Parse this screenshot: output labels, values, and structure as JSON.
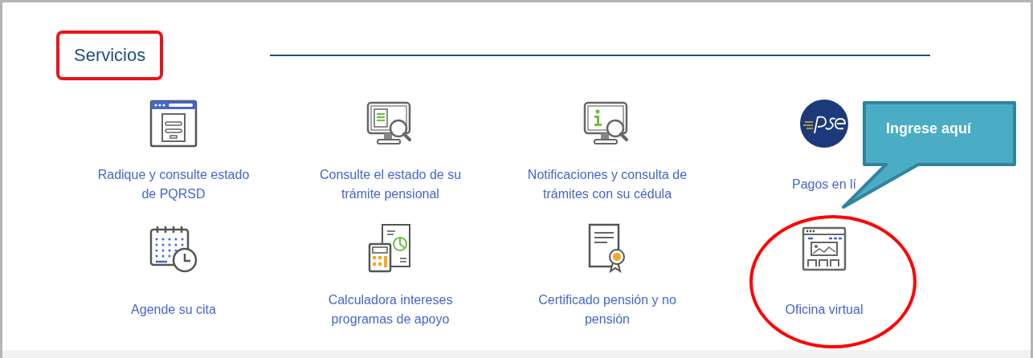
{
  "section": {
    "title": "Servicios",
    "boxed": true
  },
  "services": [
    {
      "label": "Radique y consulte estado\nde PQRSD",
      "kind": "form",
      "circled": false
    },
    {
      "label": "Consulte el estado de su\ntrámite pensional",
      "kind": "monitor-doc",
      "circled": false
    },
    {
      "label": "Notificaciones y consulta de\ntrámites con su cédula",
      "kind": "monitor-info",
      "circled": false
    },
    {
      "label": "Pagos en lí",
      "kind": "pse",
      "circled": false
    },
    {
      "label": "Agende su cita",
      "kind": "calendar",
      "circled": false
    },
    {
      "label": "Calculadora intereses\nprogramas de apoyo",
      "kind": "calculator",
      "circled": false
    },
    {
      "label": "Certificado pensión y no\npensión",
      "kind": "certificate",
      "circled": false
    },
    {
      "label": "Oficina virtual",
      "kind": "webpage",
      "circled": true
    }
  ],
  "callout": {
    "text": "Ingrese aquí"
  }
}
